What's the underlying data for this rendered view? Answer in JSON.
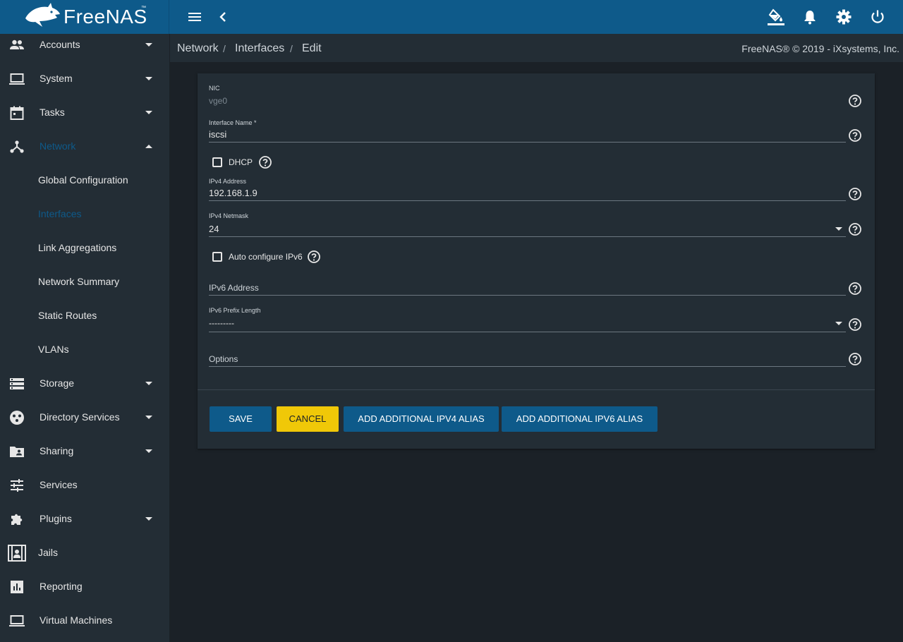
{
  "app": {
    "brand": "FreeNAS",
    "brand_tm": "™",
    "colors": {
      "topbar": "#0e5a8a",
      "sidebar": "#232d35",
      "content_bg": "#1b2127",
      "accent": "#0e5a8a",
      "cancel": "#f0c808"
    }
  },
  "topbar": {
    "icons": [
      "menu-icon",
      "chevron-left-icon",
      "theme-paint-icon",
      "bell-icon",
      "gear-icon",
      "power-icon"
    ]
  },
  "sidebar": {
    "items": [
      {
        "label": "Accounts",
        "icon": "people-icon",
        "expandable": true
      },
      {
        "label": "System",
        "icon": "laptop-icon",
        "expandable": true
      },
      {
        "label": "Tasks",
        "icon": "calendar-icon",
        "expandable": true
      },
      {
        "label": "Network",
        "icon": "network-icon",
        "expanded": true
      },
      {
        "label": "Global Configuration"
      },
      {
        "label": "Interfaces",
        "active": true
      },
      {
        "label": "Link Aggregations"
      },
      {
        "label": "Network Summary"
      },
      {
        "label": "Static Routes"
      },
      {
        "label": "VLANs"
      },
      {
        "label": "Storage",
        "icon": "storage-icon",
        "expandable": true
      },
      {
        "label": "Directory Services",
        "icon": "directory-icon",
        "expandable": true
      },
      {
        "label": "Sharing",
        "icon": "folder-shared-icon",
        "expandable": true
      },
      {
        "label": "Services",
        "icon": "tune-icon"
      },
      {
        "label": "Plugins",
        "icon": "puzzle-icon",
        "expandable": true
      },
      {
        "label": "Jails",
        "icon": "jail-icon"
      },
      {
        "label": "Reporting",
        "icon": "chart-icon"
      },
      {
        "label": "Virtual Machines",
        "icon": "computer-icon"
      }
    ]
  },
  "breadcrumb": {
    "items": [
      "Network",
      "Interfaces",
      "Edit"
    ],
    "separator": "/",
    "copyright": "FreeNAS® © 2019 - iXsystems, Inc."
  },
  "form": {
    "nic": {
      "label": "NIC",
      "value": "vge0"
    },
    "interface_name": {
      "label": "Interface Name *",
      "value": "iscsi"
    },
    "dhcp": {
      "label": "DHCP",
      "checked": false
    },
    "ipv4_address": {
      "label": "IPv4 Address",
      "value": "192.168.1.9"
    },
    "ipv4_netmask": {
      "label": "IPv4 Netmask",
      "value": "24"
    },
    "auto_ipv6": {
      "label": "Auto configure IPv6",
      "checked": false
    },
    "ipv6_address": {
      "placeholder": "IPv6 Address"
    },
    "ipv6_prefix": {
      "label": "IPv6 Prefix Length",
      "value": "---------"
    },
    "options": {
      "placeholder": "Options"
    }
  },
  "buttons": {
    "save": "SAVE",
    "cancel": "CANCEL",
    "add_ipv4": "ADD ADDITIONAL IPV4 ALIAS",
    "add_ipv6": "ADD ADDITIONAL IPV6 ALIAS"
  }
}
